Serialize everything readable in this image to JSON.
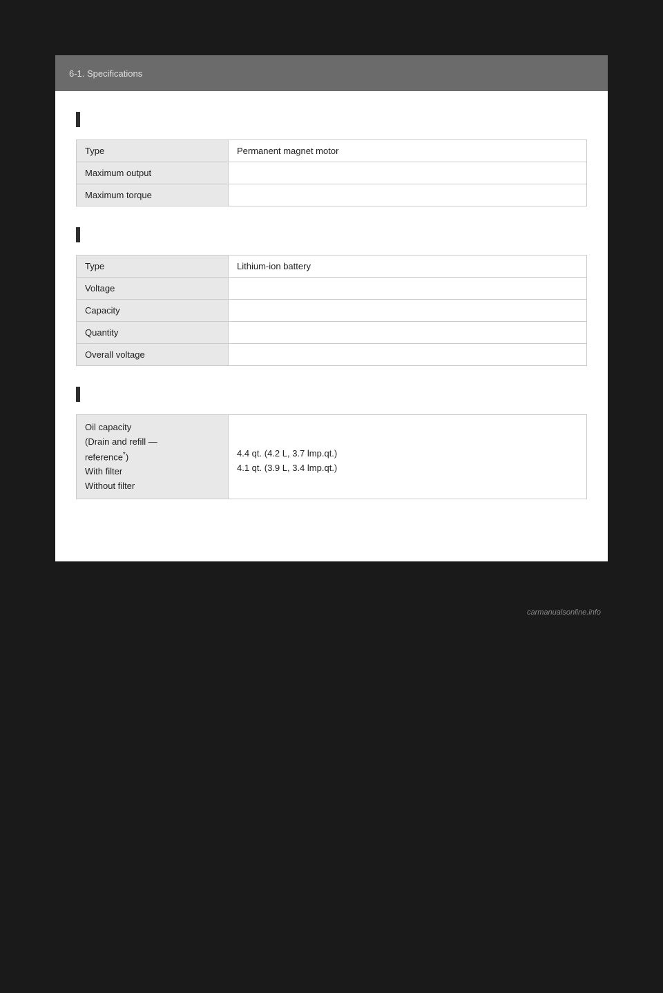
{
  "header": {
    "section": "6-1. Specifications"
  },
  "colors": {
    "header_bg": "#6b6b6b",
    "page_bg": "#1a1a1a",
    "content_bg": "#ffffff",
    "label_bg": "#e8e8e8",
    "marker_bg": "#2d2d2d"
  },
  "sections": [
    {
      "id": "electric-motor",
      "rows": [
        {
          "label": "Type",
          "value": "Permanent magnet motor"
        },
        {
          "label": "Maximum output",
          "value": ""
        },
        {
          "label": "Maximum torque",
          "value": ""
        }
      ]
    },
    {
      "id": "hv-battery",
      "rows": [
        {
          "label": "Type",
          "value": "Lithium-ion battery"
        },
        {
          "label": "Voltage",
          "value": ""
        },
        {
          "label": "Capacity",
          "value": ""
        },
        {
          "label": "Quantity",
          "value": ""
        },
        {
          "label": "Overall voltage",
          "value": ""
        }
      ]
    },
    {
      "id": "engine-oil",
      "rows": [
        {
          "label": "Oil capacity\n(Drain and refill —\nreference*)\nWith filter\nWithout filter",
          "label_parts": [
            "Oil capacity",
            "(Drain and refill —",
            "reference",
            ")",
            "With filter",
            "Without filter"
          ],
          "value_parts": [
            "4.4 qt. (4.2 L, 3.7 lmp.qt.)",
            "4.1 qt. (3.9 L, 3.4 lmp.qt.)"
          ]
        }
      ]
    }
  ],
  "footer": {
    "logo_text": "carmanualsonline.info"
  }
}
